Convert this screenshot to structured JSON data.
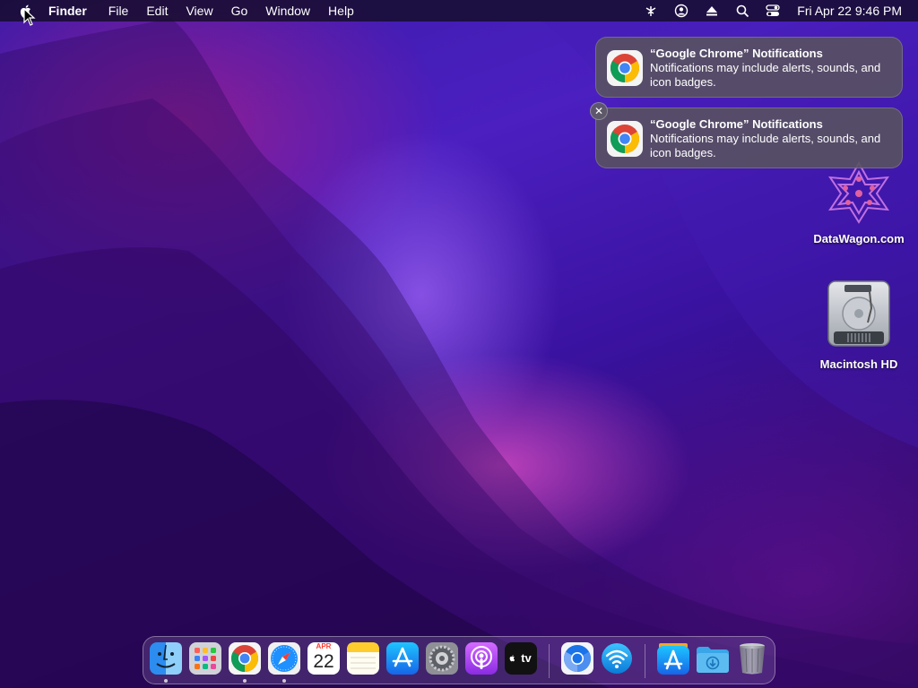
{
  "menubar": {
    "app_name": "Finder",
    "menus": [
      "File",
      "Edit",
      "View",
      "Go",
      "Window",
      "Help"
    ],
    "clock": "Fri Apr 22  9:46 PM",
    "status_icons": [
      "wifi-signal-icon",
      "user-icon",
      "eject-icon",
      "search-icon",
      "control-center-icon"
    ]
  },
  "notifications": [
    {
      "app_icon": "chrome-icon",
      "title": "“Google Chrome” Notifications",
      "body": "Notifications may include alerts, sounds, and icon badges."
    },
    {
      "app_icon": "chrome-icon",
      "title": "“Google Chrome” Notifications",
      "body": "Notifications may include alerts, sounds, and icon badges."
    }
  ],
  "notification_close_symbol": "✕",
  "desktop_icons": [
    {
      "label": "DataWagon.com",
      "icon": "datawagon-logo-icon"
    },
    {
      "label": "Macintosh HD",
      "icon": "hard-drive-icon"
    }
  ],
  "dock": {
    "calendar_month": "APR",
    "calendar_day": "22",
    "apple_tv_label": "tv",
    "apps": [
      "finder",
      "launchpad",
      "chrome",
      "safari",
      "calendar",
      "notes",
      "app-store",
      "system-preferences",
      "podcasts",
      "apple-tv",
      "chromium",
      "wifi-utility",
      "app-store-folder",
      "downloads",
      "trash"
    ]
  },
  "colors": {
    "menubar_bg": "#140c28",
    "notification_bg": "#585260",
    "wallpaper_primary": "#3a1aa8",
    "wallpaper_accent": "#e650c8"
  }
}
